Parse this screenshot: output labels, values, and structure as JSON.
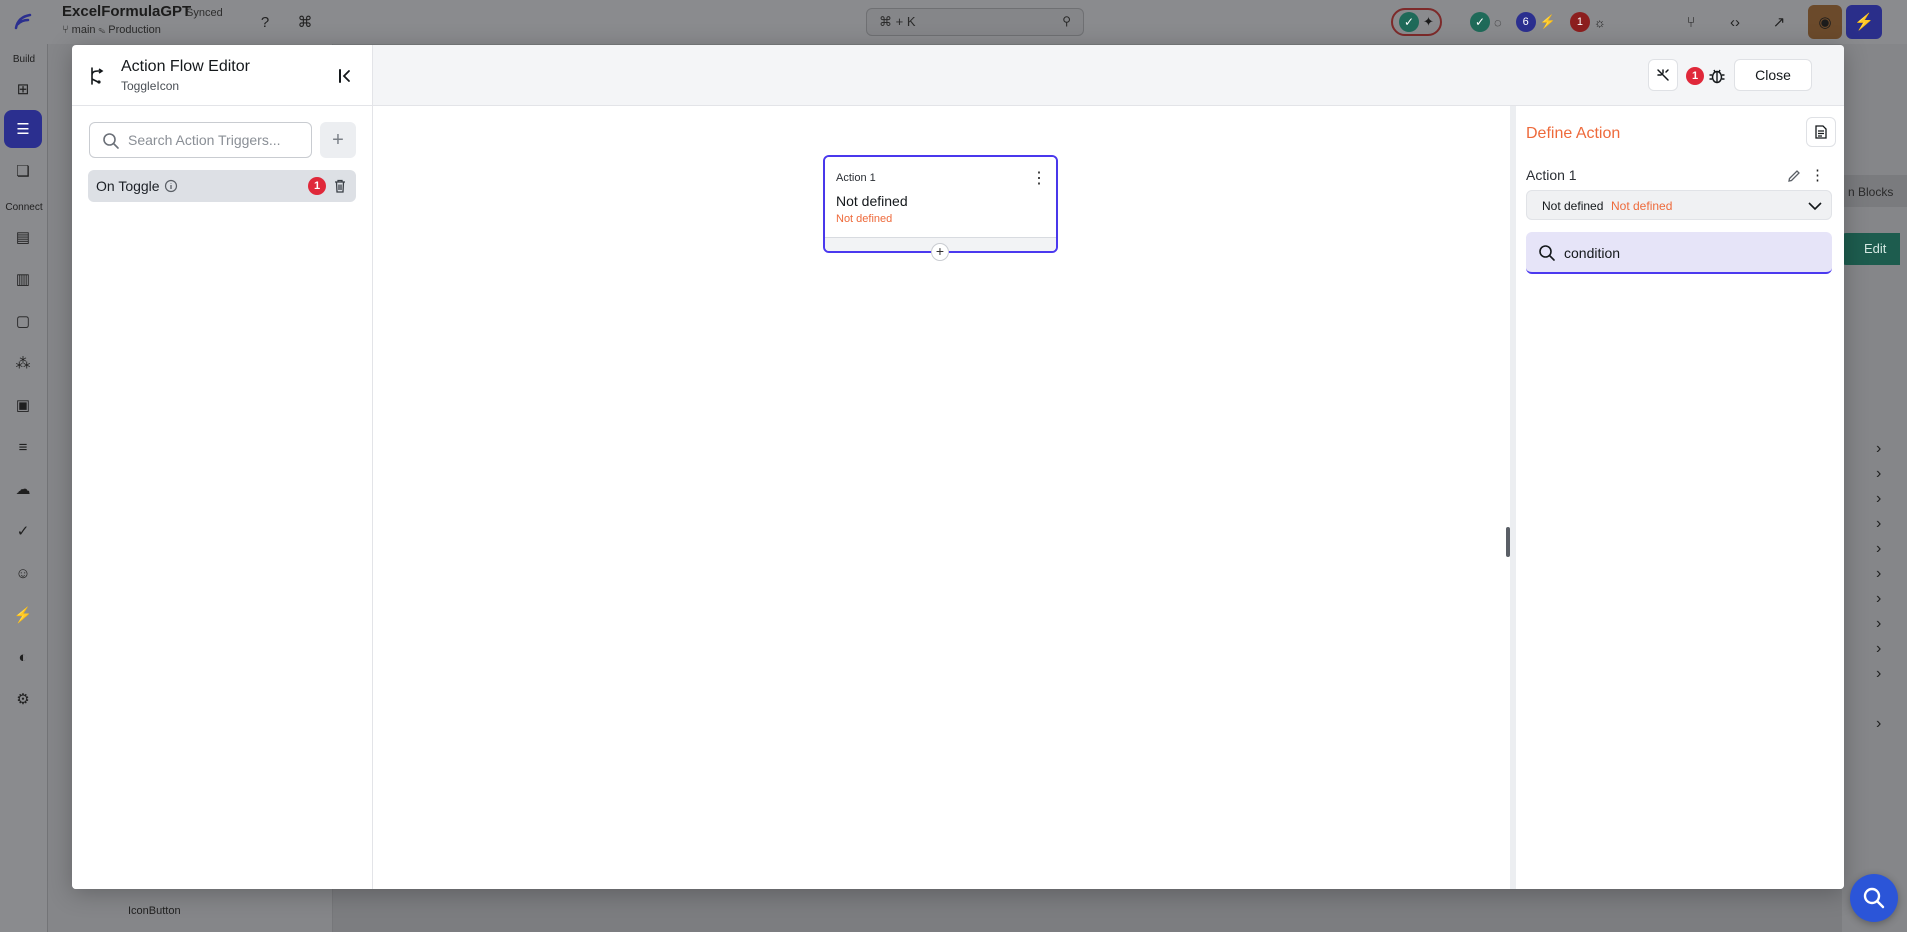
{
  "app": {
    "title": "ExcelFormulaGPT",
    "sync_status": "Synced",
    "branch": "main",
    "environment": "Production",
    "search_shortcut": "⌘ + K",
    "status_counts": {
      "issues": "6",
      "errors": "1"
    }
  },
  "left_rail": {
    "build_label": "Build",
    "connect_label": "Connect"
  },
  "background": {
    "icon_button_label": "IconButton",
    "blocks_label": "n Blocks",
    "edit_label": "Edit"
  },
  "modal": {
    "title": "Action Flow Editor",
    "subtitle": "ToggleIcon",
    "error_count": "1",
    "close_label": "Close"
  },
  "triggers": {
    "search_placeholder": "Search Action Triggers...",
    "items": [
      {
        "label": "On Toggle",
        "badge": "1"
      }
    ]
  },
  "canvas": {
    "node": {
      "step": "Action 1",
      "title": "Not defined",
      "subtitle": "Not defined"
    }
  },
  "define_action": {
    "title": "Define Action",
    "action_name": "Action 1",
    "select_value": "Not defined",
    "select_status": "Not defined",
    "search_value": "condition"
  },
  "colors": {
    "accent": "#4b39ef",
    "warning": "#ee6a3b",
    "error": "#e0283a"
  }
}
